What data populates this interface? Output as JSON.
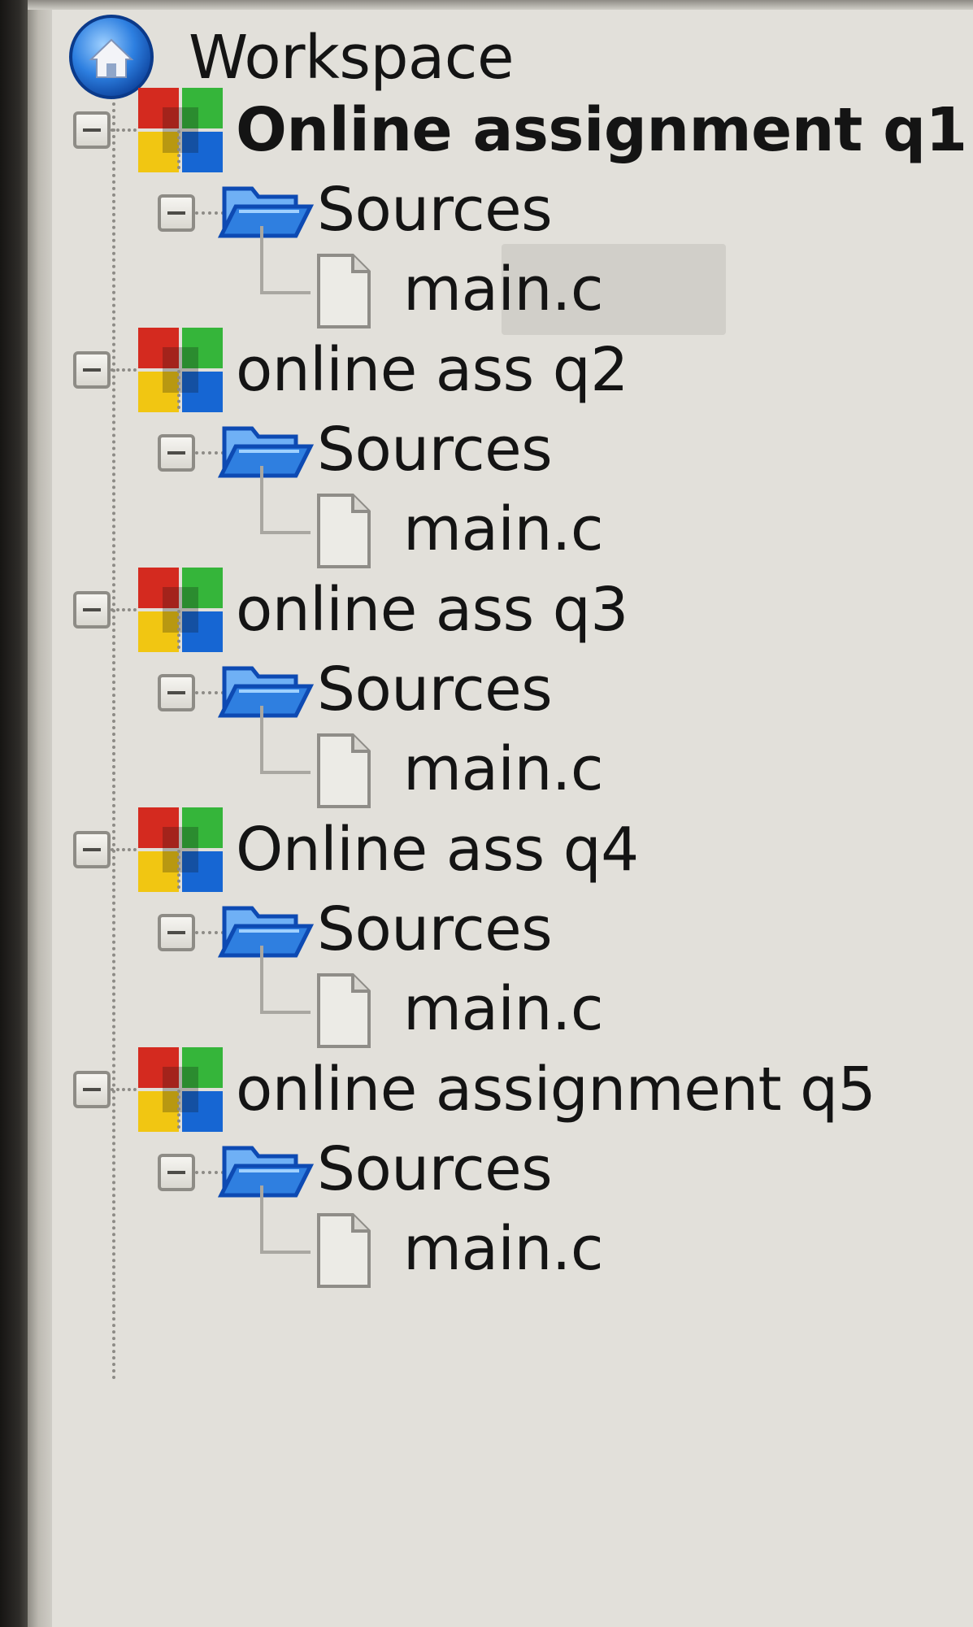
{
  "workspace": {
    "label": "Workspace",
    "icon": "workspace-home-icon"
  },
  "projects": [
    {
      "name": "Online assignment q1",
      "bold": true,
      "icon": "project-icon",
      "folder": {
        "label": "Sources",
        "icon": "folder-open-icon"
      },
      "files": [
        {
          "name": "main.c",
          "icon": "file-icon",
          "selected": true
        }
      ]
    },
    {
      "name": "online ass q2",
      "bold": false,
      "icon": "project-icon",
      "folder": {
        "label": "Sources",
        "icon": "folder-open-icon"
      },
      "files": [
        {
          "name": "main.c",
          "icon": "file-icon",
          "selected": false
        }
      ]
    },
    {
      "name": "online ass q3",
      "bold": false,
      "icon": "project-icon",
      "folder": {
        "label": "Sources",
        "icon": "folder-open-icon"
      },
      "files": [
        {
          "name": "main.c",
          "icon": "file-icon",
          "selected": false
        }
      ]
    },
    {
      "name": "Online ass q4",
      "bold": false,
      "icon": "project-icon",
      "folder": {
        "label": "Sources",
        "icon": "folder-open-icon"
      },
      "files": [
        {
          "name": "main.c",
          "icon": "file-icon",
          "selected": false
        }
      ]
    },
    {
      "name": "online assignment q5",
      "bold": false,
      "icon": "project-icon",
      "folder": {
        "label": "Sources",
        "icon": "folder-open-icon"
      },
      "files": [
        {
          "name": "main.c",
          "icon": "file-icon",
          "selected": false
        }
      ]
    }
  ],
  "colors": {
    "panel_background": "#e2e0da",
    "text": "#141414",
    "selection": "#d1cfc9",
    "tree_line": "#8d8b86",
    "project_red": "#d42a1f",
    "project_green": "#35b53a",
    "project_yellow": "#f1c612",
    "project_blue": "#1666d3",
    "folder_blue": "#2f7fe0"
  }
}
